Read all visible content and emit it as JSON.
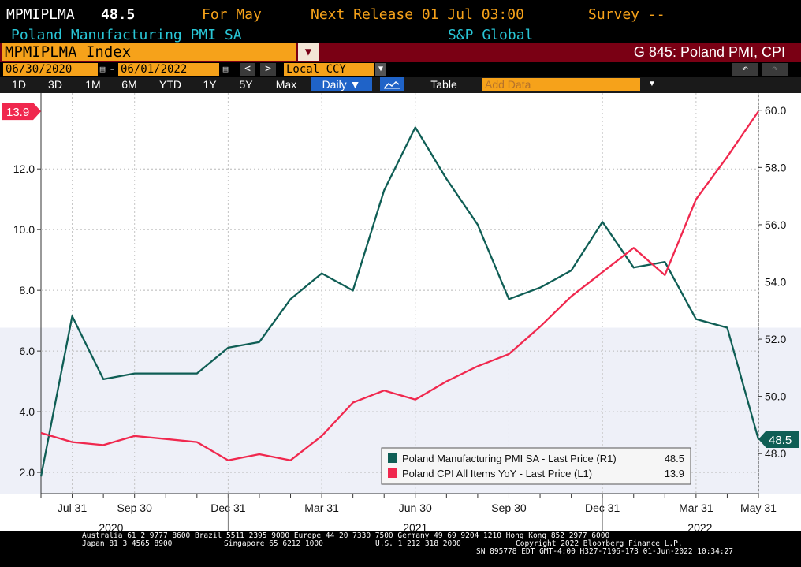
{
  "header": {
    "ticker": "MPMIPLMA",
    "last_value": "48.5",
    "for_label": "For May",
    "next_release": "Next Release 01 Jul 03:00",
    "survey": "Survey --",
    "name": "Poland Manufacturing PMI SA",
    "source": "S&P Global"
  },
  "index_bar": {
    "security": "MPMIPLMA Index",
    "dropdown_icon": "dropdown-icon",
    "graph_name": "G 845: Poland PMI, CPI"
  },
  "date_row": {
    "start_date": "06/30/2020",
    "end_date": "06/01/2022",
    "dash": "-",
    "prev": "<",
    "next": ">",
    "currency": "Local CCY",
    "undo": "↶",
    "redo": "↷"
  },
  "toolbar": {
    "ranges": [
      "1D",
      "3D",
      "1M",
      "6M",
      "YTD",
      "1Y",
      "5Y",
      "Max"
    ],
    "frequency": "Daily ▼",
    "table": "Table",
    "add_data_placeholder": "Add Data"
  },
  "colors": {
    "pmi": "#0f5e55",
    "cpi": "#f0284e",
    "orange": "#f6a21a",
    "maroon": "#7a0014"
  },
  "chart_data": {
    "type": "line",
    "x": [
      "2020-06-30",
      "2020-07-31",
      "2020-08-31",
      "2020-09-30",
      "2020-10-31",
      "2020-11-30",
      "2020-12-31",
      "2021-01-31",
      "2021-02-28",
      "2021-03-31",
      "2021-04-30",
      "2021-05-31",
      "2021-06-30",
      "2021-07-31",
      "2021-08-31",
      "2021-09-30",
      "2021-10-31",
      "2021-11-30",
      "2021-12-31",
      "2022-01-31",
      "2022-02-28",
      "2022-03-31",
      "2022-04-30",
      "2022-05-31"
    ],
    "series": [
      {
        "name": "Poland Manufacturing PMI SA - Last Price (R1)",
        "axis": "right",
        "last_label": "48.5",
        "values": [
          47.2,
          52.8,
          50.6,
          50.8,
          50.8,
          50.8,
          51.7,
          51.9,
          53.4,
          54.3,
          53.7,
          57.2,
          59.4,
          57.6,
          56.0,
          53.4,
          53.8,
          54.4,
          56.1,
          54.5,
          54.7,
          52.7,
          52.4,
          48.5
        ]
      },
      {
        "name": "Poland CPI All Items YoY - Last Price (L1)",
        "axis": "left",
        "last_label": "13.9",
        "values": [
          3.3,
          3.0,
          2.9,
          3.2,
          3.1,
          3.0,
          2.4,
          2.6,
          2.4,
          3.2,
          4.3,
          4.7,
          4.4,
          5.0,
          5.5,
          5.9,
          6.8,
          7.8,
          8.6,
          9.4,
          8.5,
          11.0,
          12.4,
          13.9
        ]
      }
    ],
    "left_axis": {
      "ylim": [
        1.3,
        14.5
      ],
      "ticks": [
        "2.0",
        "4.0",
        "6.0",
        "8.0",
        "10.0",
        "12.0"
      ]
    },
    "right_axis": {
      "ylim": [
        46.6,
        60.6
      ],
      "ticks": [
        "48.0",
        "50.0",
        "52.0",
        "54.0",
        "56.0",
        "58.0",
        "60.0"
      ]
    },
    "x_tick_labels": [
      "Jul 31",
      "Sep 30",
      "Dec 31",
      "Mar 31",
      "Jun 30",
      "Sep 30",
      "Dec 31",
      "Mar 31",
      "May 31"
    ],
    "year_labels": [
      "2020",
      "2021",
      "2022"
    ],
    "legend_placement": "bottom-right",
    "grid": true
  },
  "legend": [
    {
      "label": "Poland Manufacturing PMI SA - Last Price (R1)",
      "value": "48.5"
    },
    {
      "label": "Poland CPI All Items YoY - Last Price (L1)",
      "value": "13.9"
    }
  ],
  "footer": {
    "line1": "Australia 61 2 9777 8600 Brazil 5511 2395 9000 Europe 44 20 7330 7500 Germany 49 69 9204 1210 Hong Kong 852 2977 6000",
    "line2a": "Japan 81 3 4565 8900",
    "line2b": "Singapore 65 6212 1000",
    "line2c": "U.S. 1 212 318 2000",
    "line2d": "Copyright 2022 Bloomberg Finance L.P.",
    "line3": "SN 895778 EDT  GMT-4:00 H327-7196-173 01-Jun-2022 10:34:27"
  }
}
